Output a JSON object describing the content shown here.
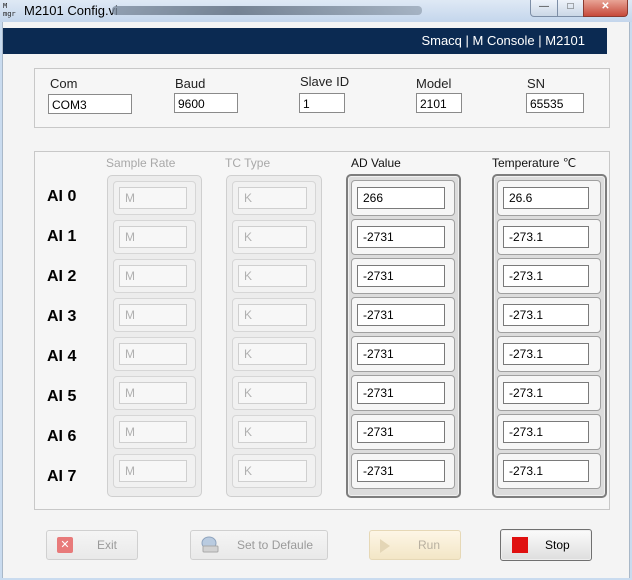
{
  "window": {
    "title": "M2101 Config.vi",
    "icon_text": "M\nmgr"
  },
  "header": {
    "text": "Smacq | M Console | M2101"
  },
  "config": {
    "com": {
      "label": "Com",
      "value": "COM3"
    },
    "baud": {
      "label": "Baud",
      "value": "9600"
    },
    "slave_id": {
      "label": "Slave ID",
      "value": "1"
    },
    "model": {
      "label": "Model",
      "value": "2101"
    },
    "sn": {
      "label": "SN",
      "value": "65535"
    }
  },
  "columns": {
    "sample_rate": "Sample Rate",
    "tc_type": "TC Type",
    "ad_value": "AD Value",
    "temperature": "Temperature ℃"
  },
  "channels": [
    {
      "label": "AI 0",
      "sample_rate": "M",
      "tc_type": "K",
      "ad_value": "266",
      "temperature": "26.6"
    },
    {
      "label": "AI 1",
      "sample_rate": "M",
      "tc_type": "K",
      "ad_value": "-2731",
      "temperature": "-273.1"
    },
    {
      "label": "AI 2",
      "sample_rate": "M",
      "tc_type": "K",
      "ad_value": "-2731",
      "temperature": "-273.1"
    },
    {
      "label": "AI 3",
      "sample_rate": "M",
      "tc_type": "K",
      "ad_value": "-2731",
      "temperature": "-273.1"
    },
    {
      "label": "AI 4",
      "sample_rate": "M",
      "tc_type": "K",
      "ad_value": "-2731",
      "temperature": "-273.1"
    },
    {
      "label": "AI 5",
      "sample_rate": "M",
      "tc_type": "K",
      "ad_value": "-2731",
      "temperature": "-273.1"
    },
    {
      "label": "AI 6",
      "sample_rate": "M",
      "tc_type": "K",
      "ad_value": "-2731",
      "temperature": "-273.1"
    },
    {
      "label": "AI 7",
      "sample_rate": "M",
      "tc_type": "K",
      "ad_value": "-2731",
      "temperature": "-273.1"
    }
  ],
  "buttons": {
    "exit": "Exit",
    "set_default": "Set to Defaule",
    "run": "Run",
    "stop": "Stop"
  },
  "colors": {
    "header_bg": "#0b2a52",
    "stop_red": "#e01010",
    "exit_red": "#e05a5a"
  }
}
